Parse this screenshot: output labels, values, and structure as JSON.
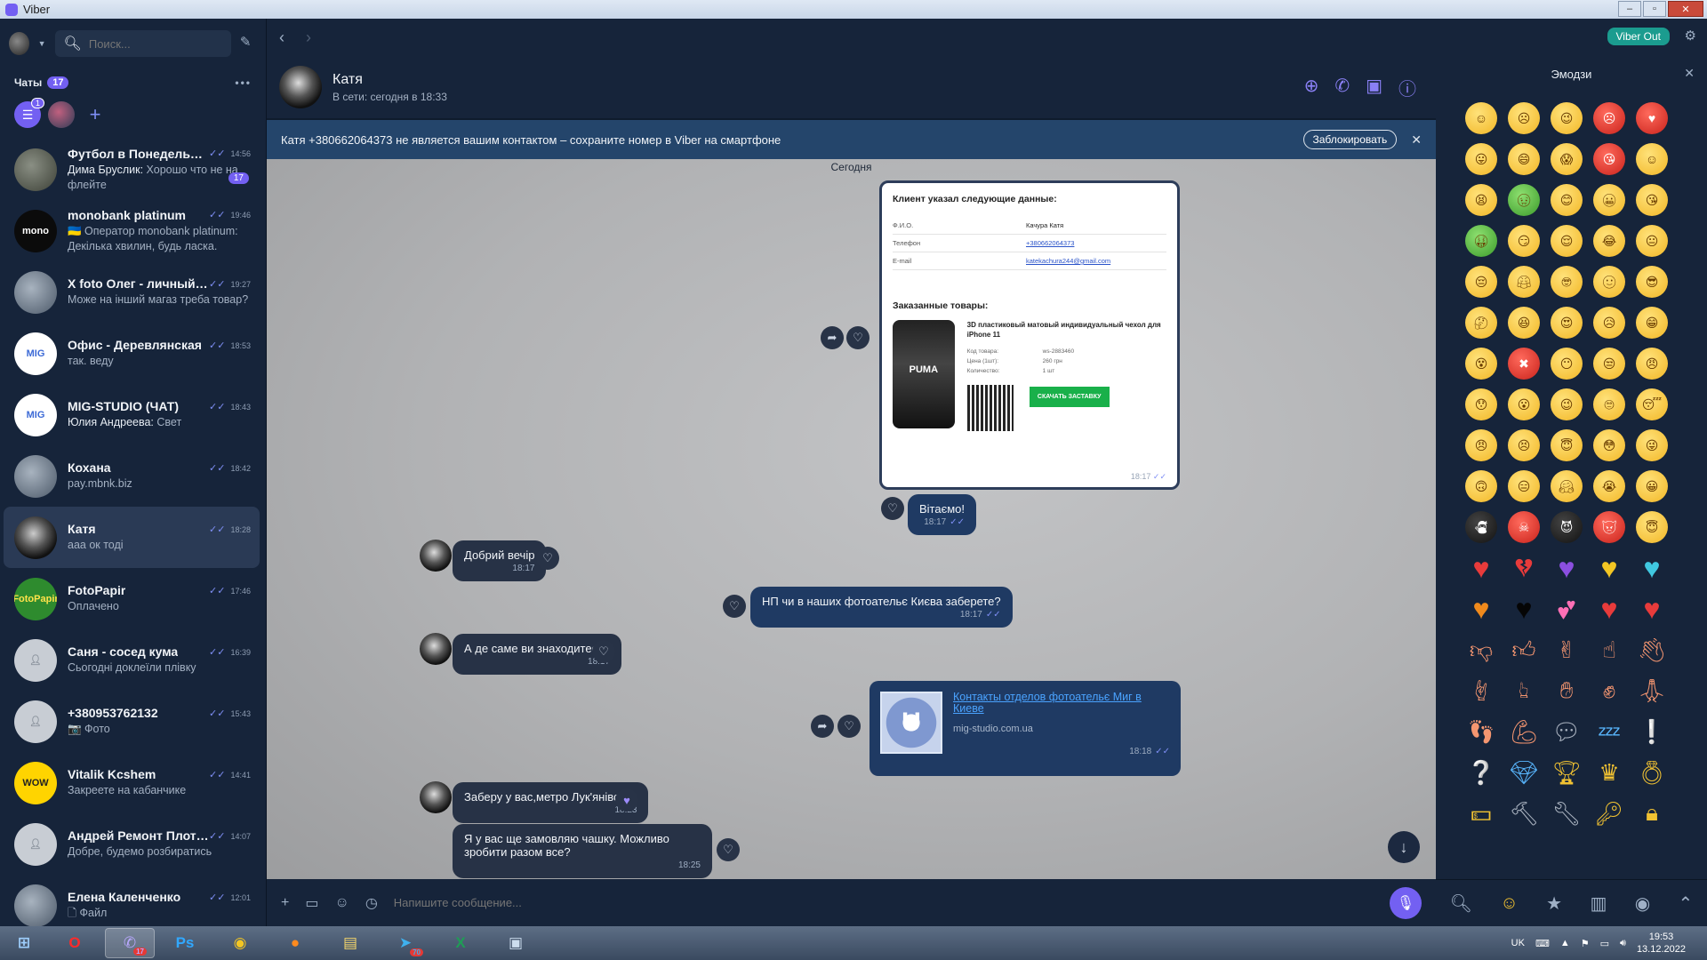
{
  "window": {
    "title": "Viber"
  },
  "sidebar": {
    "search_placeholder": "Поиск...",
    "chats_label": "Чаты",
    "chats_count": "17",
    "filter_badge": "1",
    "chats": [
      {
        "name": "Футбол в Понедельник",
        "preview_sender": "Дима Бруслик:",
        "preview": "Хорошо что не на флейте",
        "time": "14:56",
        "unread": "17",
        "avatar": "soccer"
      },
      {
        "name": "monobank platinum",
        "preview_sender": "",
        "preview": "🇺🇦 Оператор monobank platinum: Декілька хвилин, будь ласка.",
        "time": "19:46",
        "avatar": "monobank"
      },
      {
        "name": "X foto Олег - личный ...",
        "preview_sender": "",
        "preview": "Може на інший магаз треба товар?",
        "time": "19:27",
        "avatar": "photo"
      },
      {
        "name": "Офис - Деревлянская",
        "preview_sender": "",
        "preview": "так. веду",
        "time": "18:53",
        "avatar": "MIG"
      },
      {
        "name": "MIG-STUDIO (ЧАТ)",
        "preview_sender": "Юлия Андреева:",
        "preview": "Свет",
        "time": "18:43",
        "avatar": "MIG"
      },
      {
        "name": "Кохана",
        "preview_sender": "",
        "preview": "pay.mbnk.biz",
        "time": "18:42",
        "avatar": "photo"
      },
      {
        "name": "Катя",
        "preview_sender": "",
        "preview": "ааа ок тоді",
        "time": "18:28",
        "avatar": "dark"
      },
      {
        "name": "FotoPapir",
        "preview_sender": "",
        "preview": "Оплачено",
        "time": "17:46",
        "avatar": "FotoPapir"
      },
      {
        "name": "Саня - сосед кума",
        "preview_sender": "",
        "preview": "Сьогодні доклеїли плівку",
        "time": "16:39",
        "avatar": "person"
      },
      {
        "name": "+380953762132",
        "preview_sender": "",
        "preview": "📷 Фото",
        "time": "15:43",
        "avatar": "person"
      },
      {
        "name": "Vitalik Kcshem",
        "preview_sender": "",
        "preview": "Закреете на кабанчике",
        "time": "14:41",
        "avatar": "WOW"
      },
      {
        "name": "Андрей Ремонт Плоттера",
        "preview_sender": "",
        "preview": "Добре, будемо розбиратись",
        "time": "14:07",
        "avatar": "person"
      },
      {
        "name": "Елена Каленченко",
        "preview_sender": "",
        "preview": "🗋 Файл",
        "time": "12:01",
        "avatar": "photo"
      }
    ]
  },
  "topnav": {
    "viber_out": "Viber Out"
  },
  "chat": {
    "name": "Катя",
    "status": "В сети: сегодня в 18:33",
    "banner": "Катя +380662064373 не является вашим контактом – сохраните номер в Viber на смартфоне",
    "block_label": "Заблокировать",
    "day_label": "Сегодня",
    "card": {
      "title": "Клиент указал следующие данные:",
      "rows": [
        {
          "k": "Ф.И.О.",
          "v": "Качура Катя"
        },
        {
          "k": "Телефон",
          "v": "+380662064373"
        },
        {
          "k": "E-mail",
          "v": "katekachura244@gmail.com"
        }
      ],
      "products_title": "Заказанные товары:",
      "product_name": "3D пластиковый матовый индивидуальный чехол для iPhone 11",
      "spec": [
        {
          "k": "Код товара:",
          "v": "ws-2883460"
        },
        {
          "k": "Цена (1шт):",
          "v": "260 грн"
        },
        {
          "k": "Количество:",
          "v": "1 шт"
        }
      ],
      "phone_brand": "PUMA",
      "download": "СКАЧАТЬ ЗАСТАВКУ",
      "time": "18:17"
    },
    "messages": [
      {
        "dir": "out",
        "text": "Вітаємо!",
        "time": "18:17"
      },
      {
        "dir": "in",
        "text": "Добрий вечір",
        "time": "18:17"
      },
      {
        "dir": "out",
        "text": "НП чи в наших фотоательє Києва заберете?",
        "time": "18:17"
      },
      {
        "dir": "in",
        "text": "А де саме ви знаходитесь?",
        "time": "18:17"
      },
      {
        "dir": "in",
        "text": "Заберу у вас,метро Лук'янівська",
        "time": "18:23"
      },
      {
        "dir": "in",
        "text": "Я у вас ще замовляю чашку. Можливо зробити разом все?",
        "time": "18:25"
      }
    ],
    "link": {
      "title": "Контакты отделов фотоательє Миг в Киеве",
      "url": "mig-studio.com.ua",
      "time": "18:18"
    },
    "input_placeholder": "Напишите сообщение..."
  },
  "emoji_panel": {
    "title": "Эмодзи"
  },
  "taskbar": {
    "lang": "UK",
    "time": "19:53",
    "date": "13.12.2022",
    "viber_badge": "17",
    "telegram_badge": "70"
  },
  "colors": {
    "accent": "#7360f2",
    "teal": "#1b9c8f",
    "banner": "#24456b"
  }
}
